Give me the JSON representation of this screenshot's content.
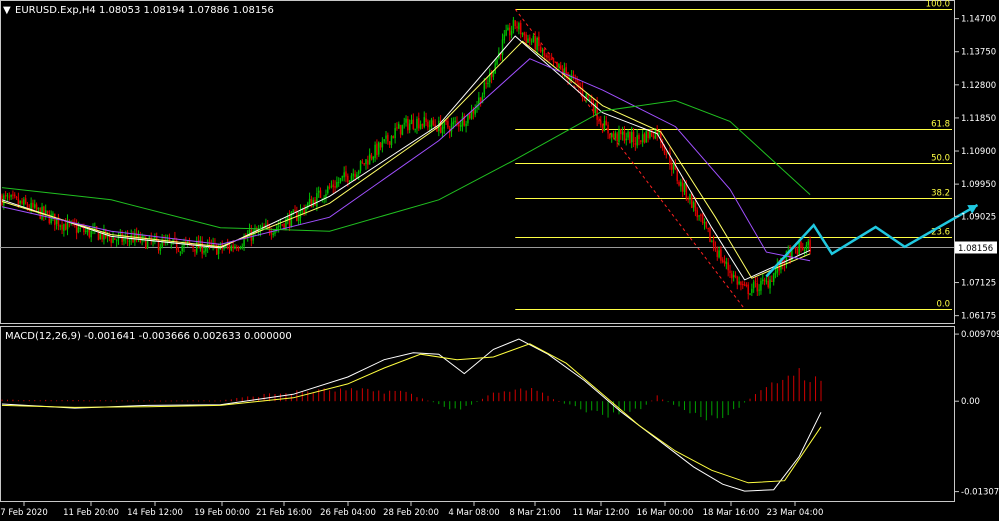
{
  "header": {
    "symbol_title": "EURUSD.Exp,H4  1.08053 1.08194 1.07886 1.08156",
    "macd_title": "MACD(12,26,9) -0.001641 -0.003666 0.002633 0.000000"
  },
  "colors": {
    "background": "#000000",
    "frame": "#c8c8c8",
    "bull_candle": "#00c000",
    "bear_candle": "#e00000",
    "ma_fast": "#ffffff",
    "ma_mid": "#ffff66",
    "ma_slow": "#a050ff",
    "ma_long": "#20c020",
    "fib_level": "#ffff44",
    "fib_trend": "#ff2020",
    "forecast_arrow": "#20c8e0",
    "macd_main": "#ffffff",
    "macd_signal": "#ffff40",
    "hist_up": "#d00000",
    "hist_down": "#00a000",
    "price_marker_bg": "#ffffff"
  },
  "chart_data": [
    {
      "type": "candlestick",
      "title": "EURUSD.Exp,H4",
      "ohlc_last": {
        "open": 1.08053,
        "high": 1.08194,
        "low": 1.07886,
        "close": 1.08156
      },
      "current_price": "1.08156",
      "ylim": [
        1.0605,
        1.1512
      ],
      "y_ticks": [
        "1.14700",
        "1.13750",
        "1.12800",
        "1.11850",
        "1.10900",
        "1.09950",
        "1.09025",
        "1.07125",
        "1.06175"
      ],
      "x_ticks": [
        "7 Feb 2020",
        "11 Feb 20:00",
        "14 Feb 12:00",
        "19 Feb 00:00",
        "21 Feb 16:00",
        "26 Feb 04:00",
        "28 Feb 20:00",
        "4 Mar 08:00",
        "8 Mar 21:00",
        "11 Mar 12:00",
        "16 Mar 00:00",
        "18 Mar 16:00",
        "23 Mar 04:00"
      ],
      "close_path": [
        [
          0,
          1.0955
        ],
        [
          6,
          1.0945
        ],
        [
          12,
          1.0935
        ],
        [
          18,
          1.092
        ],
        [
          24,
          1.0905
        ],
        [
          30,
          1.089
        ],
        [
          36,
          1.0875
        ],
        [
          42,
          1.0865
        ],
        [
          48,
          1.0855
        ],
        [
          54,
          1.085
        ],
        [
          60,
          1.084
        ],
        [
          66,
          1.0835
        ],
        [
          72,
          1.084
        ],
        [
          78,
          1.083
        ],
        [
          84,
          1.0825
        ],
        [
          90,
          1.0822
        ],
        [
          96,
          1.0818
        ],
        [
          102,
          1.082
        ],
        [
          108,
          1.0815
        ],
        [
          114,
          1.0812
        ],
        [
          120,
          1.081
        ],
        [
          126,
          1.0815
        ],
        [
          132,
          1.0832
        ],
        [
          138,
          1.0852
        ],
        [
          144,
          1.0862
        ],
        [
          150,
          1.0872
        ],
        [
          156,
          1.0888
        ],
        [
          162,
          1.0905
        ],
        [
          168,
          1.0935
        ],
        [
          174,
          1.096
        ],
        [
          180,
          1.0985
        ],
        [
          186,
          1.1005
        ],
        [
          192,
          1.1025
        ],
        [
          198,
          1.105
        ],
        [
          204,
          1.1085
        ],
        [
          210,
          1.111
        ],
        [
          216,
          1.1145
        ],
        [
          222,
          1.1165
        ],
        [
          228,
          1.1175
        ],
        [
          234,
          1.1168
        ],
        [
          240,
          1.116
        ],
        [
          246,
          1.116
        ],
        [
          252,
          1.1175
        ],
        [
          258,
          1.12
        ],
        [
          264,
          1.1255
        ],
        [
          270,
          1.133
        ],
        [
          276,
          1.141
        ],
        [
          282,
          1.1455
        ],
        [
          288,
          1.1415
        ],
        [
          294,
          1.1395
        ],
        [
          300,
          1.1345
        ],
        [
          306,
          1.1325
        ],
        [
          312,
          1.1305
        ],
        [
          318,
          1.1265
        ],
        [
          324,
          1.123
        ],
        [
          330,
          1.1165
        ],
        [
          336,
          1.113
        ],
        [
          342,
          1.1135
        ],
        [
          348,
          1.112
        ],
        [
          354,
          1.1135
        ],
        [
          360,
          1.115
        ],
        [
          366,
          1.1075
        ],
        [
          372,
          1.1
        ],
        [
          378,
          1.0955
        ],
        [
          384,
          1.0885
        ],
        [
          390,
          1.083
        ],
        [
          396,
          1.0775
        ],
        [
          402,
          1.073
        ],
        [
          408,
          1.069
        ],
        [
          414,
          1.07
        ],
        [
          420,
          1.071
        ],
        [
          426,
          1.075
        ],
        [
          432,
          1.079
        ],
        [
          438,
          1.081
        ],
        [
          444,
          1.0816
        ]
      ],
      "moving_averages": [
        {
          "color_key": "ma_fast",
          "path": [
            [
              0,
              1.095
            ],
            [
              60,
              1.0845
            ],
            [
              120,
              1.0812
            ],
            [
              180,
              1.096
            ],
            [
              240,
              1.1165
            ],
            [
              282,
              1.142
            ],
            [
              330,
              1.12
            ],
            [
              360,
              1.114
            ],
            [
              390,
              1.087
            ],
            [
              408,
              1.072
            ],
            [
              444,
              1.0805
            ]
          ]
        },
        {
          "color_key": "ma_mid",
          "path": [
            [
              0,
              1.0945
            ],
            [
              60,
              1.085
            ],
            [
              120,
              1.0815
            ],
            [
              180,
              1.094
            ],
            [
              240,
              1.116
            ],
            [
              286,
              1.1405
            ],
            [
              330,
              1.122
            ],
            [
              362,
              1.1145
            ],
            [
              392,
              1.09
            ],
            [
              412,
              1.0725
            ],
            [
              444,
              1.0795
            ]
          ]
        },
        {
          "color_key": "ma_slow",
          "path": [
            [
              0,
              1.093
            ],
            [
              60,
              1.086
            ],
            [
              120,
              1.0822
            ],
            [
              180,
              1.09
            ],
            [
              240,
              1.112
            ],
            [
              290,
              1.1355
            ],
            [
              330,
              1.1265
            ],
            [
              370,
              1.116
            ],
            [
              400,
              1.098
            ],
            [
              420,
              1.08
            ],
            [
              444,
              1.0775
            ]
          ]
        },
        {
          "color_key": "ma_long",
          "path": [
            [
              0,
              1.0985
            ],
            [
              60,
              1.095
            ],
            [
              120,
              1.087
            ],
            [
              180,
              1.086
            ],
            [
              240,
              1.095
            ],
            [
              280,
              1.106
            ],
            [
              330,
              1.1205
            ],
            [
              370,
              1.1235
            ],
            [
              400,
              1.1175
            ],
            [
              444,
              1.0965
            ]
          ]
        }
      ],
      "fibonacci": {
        "levels": [
          {
            "label": "100.0",
            "price": 1.1497
          },
          {
            "label": "61.8",
            "price": 1.1154
          },
          {
            "label": "50.0",
            "price": 1.1057
          },
          {
            "label": "38.2",
            "price": 1.0955
          },
          {
            "label": "23.6",
            "price": 1.0843
          },
          {
            "label": "0.0",
            "price": 1.0637
          }
        ],
        "from": {
          "bar": 282,
          "price": 1.1497
        },
        "to": {
          "bar": 408,
          "price": 1.0637
        }
      },
      "forecast_path": [
        [
          420,
          1.073
        ],
        [
          446,
          1.0877
        ],
        [
          456,
          1.0795
        ],
        [
          480,
          1.0872
        ],
        [
          496,
          1.0815
        ],
        [
          536,
          1.0935
        ]
      ]
    },
    {
      "type": "bar",
      "title": "MACD(12,26,9)",
      "values": {
        "main": -0.001641,
        "signal": -0.003666,
        "histogram": 0.002633,
        "zero": 0.0
      },
      "ylim": [
        -0.014,
        0.0103
      ],
      "y_ticks": [
        "0.009709",
        "0.00",
        "-0.013074"
      ],
      "main_path": [
        [
          0,
          -0.0004
        ],
        [
          40,
          -0.001
        ],
        [
          80,
          -0.0006
        ],
        [
          120,
          -0.0005
        ],
        [
          160,
          0.001
        ],
        [
          190,
          0.0035
        ],
        [
          210,
          0.006
        ],
        [
          226,
          0.007
        ],
        [
          240,
          0.0068
        ],
        [
          254,
          0.004
        ],
        [
          270,
          0.0075
        ],
        [
          284,
          0.009
        ],
        [
          300,
          0.0068
        ],
        [
          320,
          0.003
        ],
        [
          340,
          -0.0015
        ],
        [
          360,
          -0.0055
        ],
        [
          380,
          -0.0095
        ],
        [
          396,
          -0.012
        ],
        [
          408,
          -0.013
        ],
        [
          424,
          -0.0128
        ],
        [
          438,
          -0.008
        ],
        [
          450,
          -0.0016
        ]
      ],
      "signal_path": [
        [
          0,
          -0.0006
        ],
        [
          40,
          -0.0009
        ],
        [
          80,
          -0.0008
        ],
        [
          120,
          -0.0006
        ],
        [
          160,
          0.0005
        ],
        [
          190,
          0.0025
        ],
        [
          210,
          0.0048
        ],
        [
          230,
          0.0068
        ],
        [
          250,
          0.006
        ],
        [
          270,
          0.0064
        ],
        [
          290,
          0.0083
        ],
        [
          310,
          0.0055
        ],
        [
          330,
          0.001
        ],
        [
          350,
          -0.0035
        ],
        [
          370,
          -0.0072
        ],
        [
          390,
          -0.01
        ],
        [
          410,
          -0.0118
        ],
        [
          430,
          -0.0115
        ],
        [
          450,
          -0.0037
        ]
      ],
      "histogram_envelope": [
        [
          0,
          0.0002
        ],
        [
          60,
          0.0001
        ],
        [
          120,
          0.0001
        ],
        [
          150,
          0.0011
        ],
        [
          180,
          0.0016
        ],
        [
          220,
          0.0014
        ],
        [
          250,
          -0.0014
        ],
        [
          270,
          0.0011
        ],
        [
          290,
          0.0018
        ],
        [
          310,
          -0.0004
        ],
        [
          330,
          -0.0021
        ],
        [
          350,
          -0.0012
        ],
        [
          360,
          0.0007
        ],
        [
          380,
          -0.002
        ],
        [
          394,
          -0.003
        ],
        [
          410,
          0.0002
        ],
        [
          426,
          0.0028
        ],
        [
          436,
          0.0045
        ],
        [
          450,
          0.0026
        ]
      ]
    }
  ]
}
